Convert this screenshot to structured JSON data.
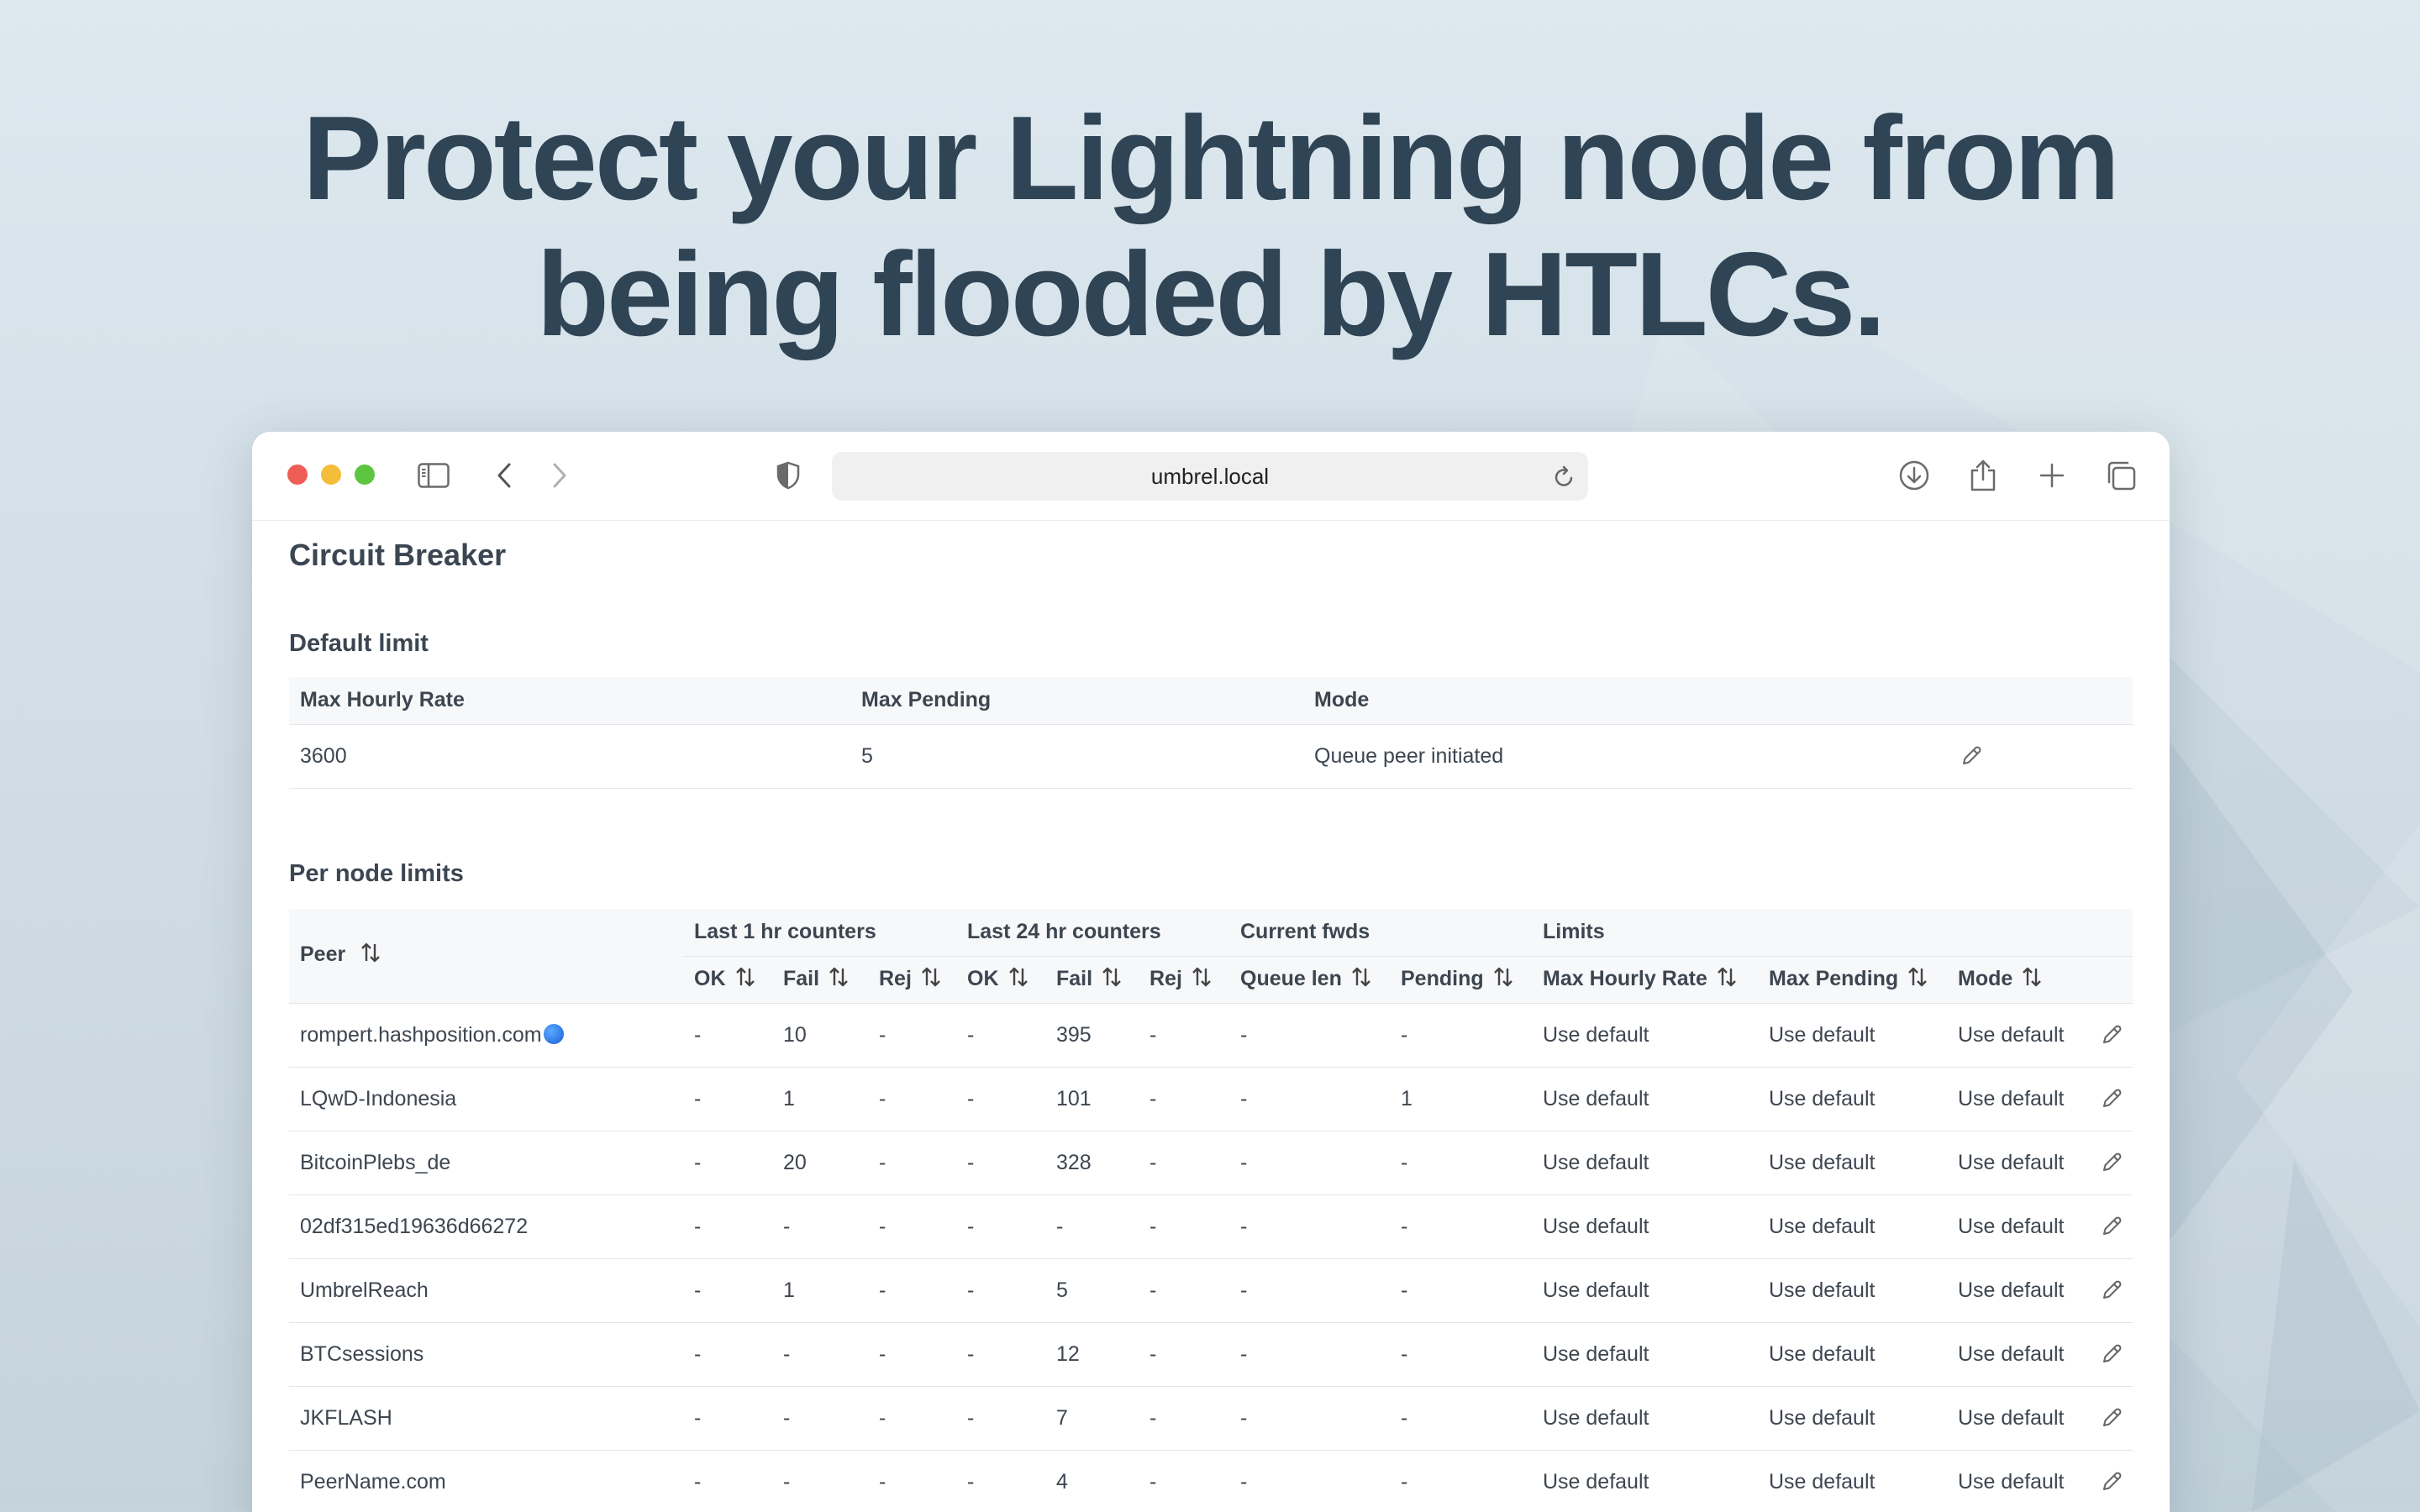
{
  "headline": {
    "line1": "Protect your Lightning node from",
    "line2": "being flooded by HTLCs."
  },
  "browser": {
    "url": "umbrel.local",
    "colors": {
      "close": "#ee5d56",
      "minimize": "#f4bd3a",
      "zoom": "#5ec541"
    },
    "icons": [
      "sidebar-icon",
      "back-icon",
      "forward-icon",
      "shield-icon",
      "reload-icon",
      "download-icon",
      "share-icon",
      "plus-icon",
      "tabs-icon"
    ]
  },
  "app": {
    "title": "Circuit Breaker",
    "default_limit": {
      "title": "Default limit",
      "headers": [
        "Max Hourly Rate",
        "Max Pending",
        "Mode"
      ],
      "row": {
        "max_hourly_rate": "3600",
        "max_pending": "5",
        "mode": "Queue peer initiated"
      }
    },
    "per_node": {
      "title": "Per node limits",
      "group_headers": {
        "peer": "Peer",
        "last1": "Last 1 hr counters",
        "last24": "Last 24 hr counters",
        "current": "Current fwds",
        "limits": "Limits"
      },
      "columns": {
        "ok1": "OK",
        "fail1": "Fail",
        "rej1": "Rej",
        "ok24": "OK",
        "fail24": "Fail",
        "rej24": "Rej",
        "queue": "Queue len",
        "pending": "Pending",
        "max_rate": "Max Hourly Rate",
        "max_pending": "Max Pending",
        "mode": "Mode"
      },
      "rows": [
        [
          "rompert.hashposition.com",
          "-",
          "10",
          "-",
          "-",
          "395",
          "-",
          "-",
          "-",
          "Use default",
          "Use default",
          "Use default"
        ],
        [
          "LQwD-Indonesia",
          "-",
          "1",
          "-",
          "-",
          "101",
          "-",
          "-",
          "1",
          "Use default",
          "Use default",
          "Use default"
        ],
        [
          "BitcoinPlebs_de",
          "-",
          "20",
          "-",
          "-",
          "328",
          "-",
          "-",
          "-",
          "Use default",
          "Use default",
          "Use default"
        ],
        [
          "02df315ed19636d66272",
          "-",
          "-",
          "-",
          "-",
          "-",
          "-",
          "-",
          "-",
          "Use default",
          "Use default",
          "Use default"
        ],
        [
          "UmbrelReach",
          "-",
          "1",
          "-",
          "-",
          "5",
          "-",
          "-",
          "-",
          "Use default",
          "Use default",
          "Use default"
        ],
        [
          "BTCsessions",
          "-",
          "-",
          "-",
          "-",
          "12",
          "-",
          "-",
          "-",
          "Use default",
          "Use default",
          "Use default"
        ],
        [
          "JKFLASH",
          "-",
          "-",
          "-",
          "-",
          "7",
          "-",
          "-",
          "-",
          "Use default",
          "Use default",
          "Use default"
        ],
        [
          "PeerName.com",
          "-",
          "-",
          "-",
          "-",
          "4",
          "-",
          "-",
          "-",
          "Use default",
          "Use default",
          "Use default"
        ]
      ]
    }
  }
}
